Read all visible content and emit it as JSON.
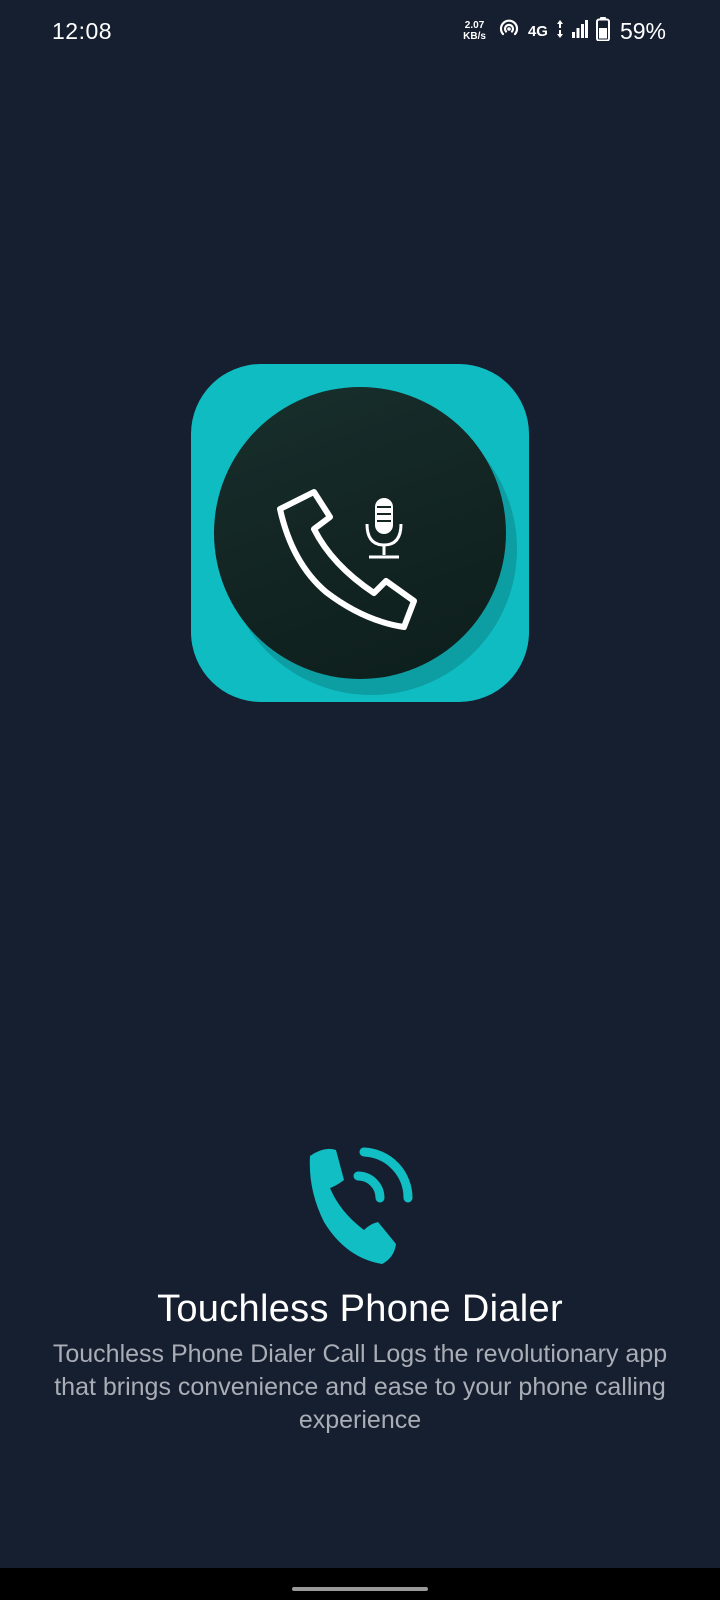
{
  "status_bar": {
    "time": "12:08",
    "net_speed_value": "2.07",
    "net_speed_unit": "KB/s",
    "network_type": "4G",
    "battery_percent": "59%",
    "icons": [
      "hotspot-icon",
      "data-arrows-icon",
      "signal-icon",
      "battery-icon"
    ]
  },
  "app_icon": {
    "icons": [
      "phone-handset-icon",
      "microphone-icon"
    ],
    "colors": {
      "tile": "#0fbcc2",
      "disc": "#132624",
      "glyph": "#ffffff"
    }
  },
  "splash": {
    "icon": "phone-ringing-icon",
    "title": "Touchless Phone Dialer",
    "description": "Touchless Phone Dialer Call Logs the revolutionary app that brings convenience and ease to your phone calling experience",
    "accent_color": "#10bec4"
  },
  "theme": {
    "background": "#161f2f"
  }
}
